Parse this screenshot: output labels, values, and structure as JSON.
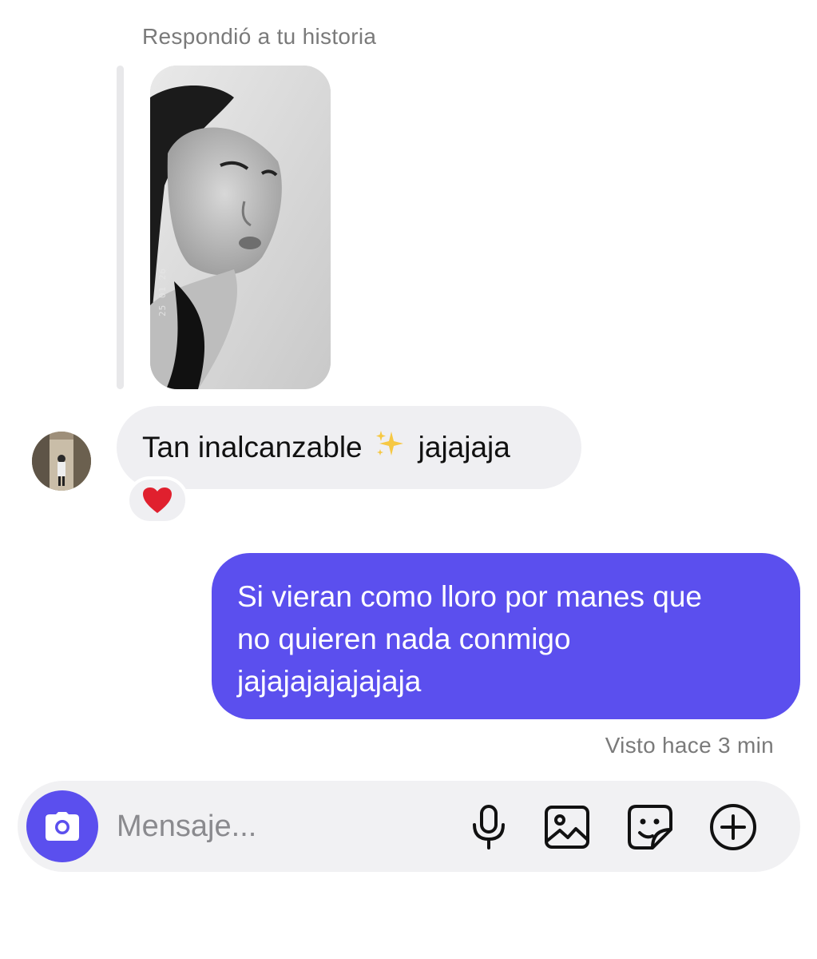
{
  "story_reply": {
    "header": "Respondió a tu historia",
    "stamp": "25 01 26"
  },
  "incoming": {
    "text_before": "Tan inalcanzable",
    "emoji": "✨",
    "text_after": "jajajaja",
    "reaction": "❤️"
  },
  "outgoing": {
    "lines": [
      "Si vieran como lloro por manes que",
      "no quieren nada conmigo",
      "jajajajajajajaja"
    ]
  },
  "status": {
    "seen": "Visto hace 3 min"
  },
  "composer": {
    "placeholder": "Mensaje...",
    "icons": [
      "camera-icon",
      "microphone-icon",
      "gallery-icon",
      "sticker-icon",
      "add-icon"
    ]
  },
  "colors": {
    "accent": "#5b4fee",
    "incoming_bubble": "#efeff2",
    "muted_text": "#7a7a7a",
    "heart": "#e0202e"
  }
}
